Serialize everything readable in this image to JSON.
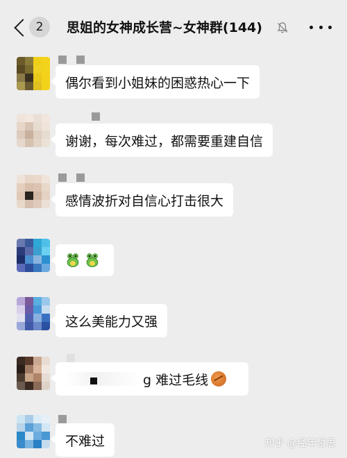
{
  "header": {
    "unread_count": "2",
    "title": "思姐的女神成长营~女神群(144)",
    "icons": {
      "back": "chevron-left-icon",
      "mute": "bell-off-icon",
      "more": "more-dots-icon"
    }
  },
  "messages": [
    {
      "text": "偶尔看到小姐妹的困惑热心一下"
    },
    {
      "text": "谢谢，每次难过，都需要重建自信"
    },
    {
      "text": "感情波折对自信心打击很大"
    },
    {
      "emoji": [
        "frog-emoji",
        "frog-emoji"
      ]
    },
    {
      "text": "这么美能力又强"
    },
    {
      "text_visible": "g 难过毛线",
      "emoji": "yarn-ball-emoji"
    },
    {
      "text": "不难过"
    }
  ],
  "watermark": "知乎 @经年哲思",
  "colors": {
    "background": "#ededed",
    "bubble": "#ffffff",
    "text": "#111111"
  }
}
